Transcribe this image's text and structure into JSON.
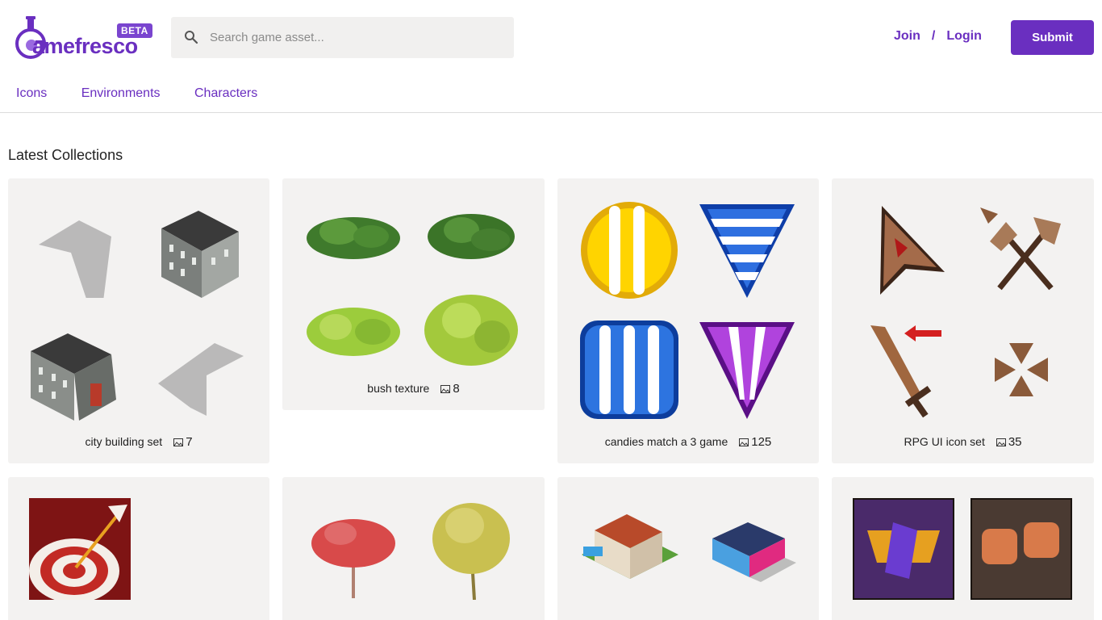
{
  "brand": {
    "name": "amefresco",
    "badge": "BETA",
    "accent": "#6a2fc0"
  },
  "search": {
    "placeholder": "Search game asset...",
    "value": ""
  },
  "auth": {
    "join": "Join",
    "separator": "/",
    "login": "Login"
  },
  "submit_label": "Submit",
  "nav": [
    "Icons",
    "Environments",
    "Characters"
  ],
  "section_title": "Latest Collections",
  "collections": [
    {
      "title": "city building set",
      "count": "7"
    },
    {
      "title": "bush texture",
      "count": "8"
    },
    {
      "title": "candies match a 3 game",
      "count": "125"
    },
    {
      "title": "RPG UI icon set",
      "count": "35"
    }
  ]
}
